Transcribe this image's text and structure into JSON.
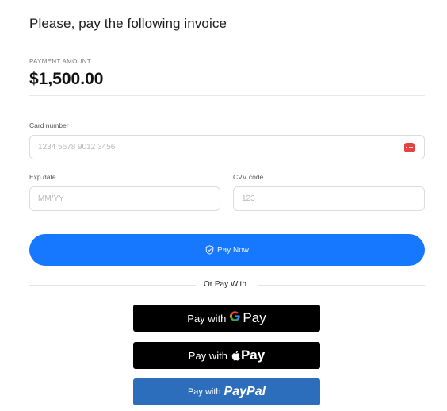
{
  "header": {
    "title": "Please, pay the following invoice"
  },
  "payment": {
    "amount_label": "PAYMENT AMOUNT",
    "amount": "$1,500.00"
  },
  "form": {
    "card_number_label": "Card number",
    "card_number_placeholder": "1234 5678 9012 3456",
    "card_icon": "credit-card-icon",
    "exp_label": "Exp date",
    "exp_placeholder": "MM/YY",
    "cvv_label": "CVV code",
    "cvv_placeholder": "123"
  },
  "actions": {
    "pay_now_label": "Pay Now",
    "pay_now_icon": "shield-check-icon",
    "divider_text": "Or Pay With",
    "google_pay_prefix": "Pay with",
    "google_pay_g": "G",
    "google_pay_brand": "Pay",
    "apple_pay_prefix": "Pay with",
    "apple_pay_brand": "Pay",
    "paypal_prefix": "Pay with",
    "paypal_brand": "PayPal"
  },
  "colors": {
    "primary": "#1677ff",
    "paypal": "#2d6ebc",
    "wallet_dark": "#000000",
    "card_icon": "#e5433f"
  }
}
